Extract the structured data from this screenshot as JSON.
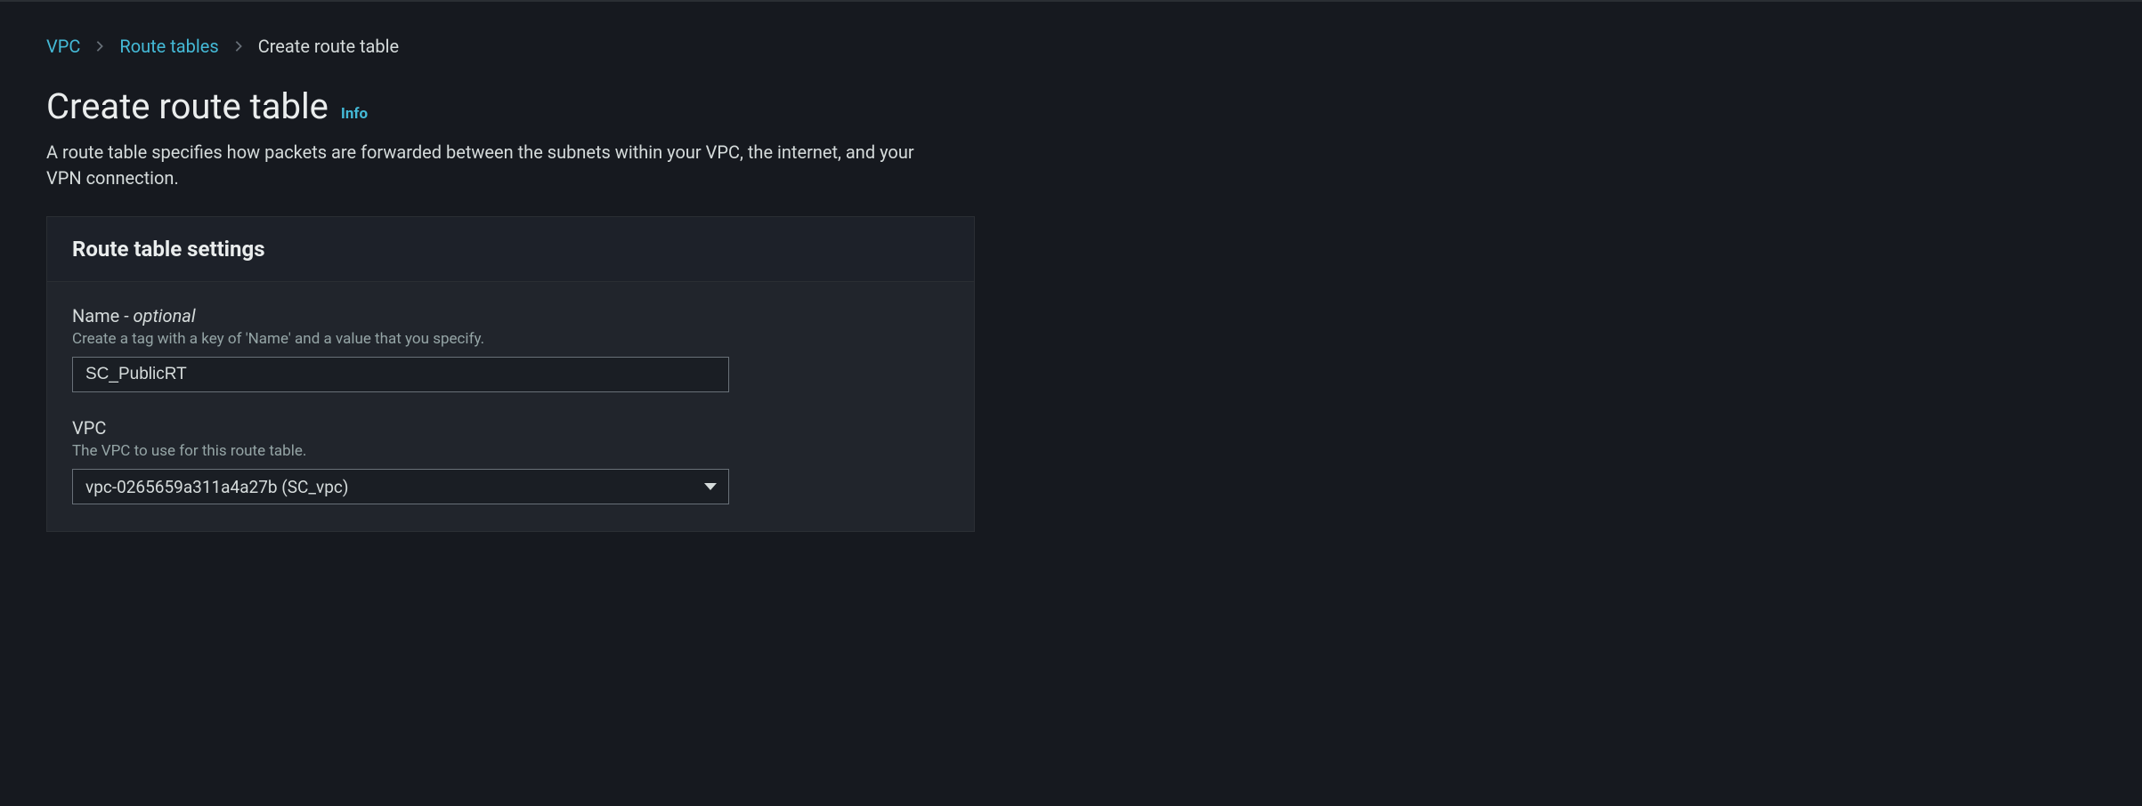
{
  "breadcrumb": {
    "items": [
      {
        "label": "VPC",
        "is_link": true
      },
      {
        "label": "Route tables",
        "is_link": true
      },
      {
        "label": "Create route table",
        "is_link": false
      }
    ]
  },
  "header": {
    "title": "Create route table",
    "info_link": "Info",
    "description": "A route table specifies how packets are forwarded between the subnets within your VPC, the internet, and your VPN connection."
  },
  "settings_panel": {
    "title": "Route table settings",
    "name_field": {
      "label": "Name",
      "suffix": " - optional",
      "hint": "Create a tag with a key of 'Name' and a value that you specify.",
      "value": "SC_PublicRT"
    },
    "vpc_field": {
      "label": "VPC",
      "hint": "The VPC to use for this route table.",
      "selected": "vpc-0265659a311a4a27b (SC_vpc)"
    }
  }
}
